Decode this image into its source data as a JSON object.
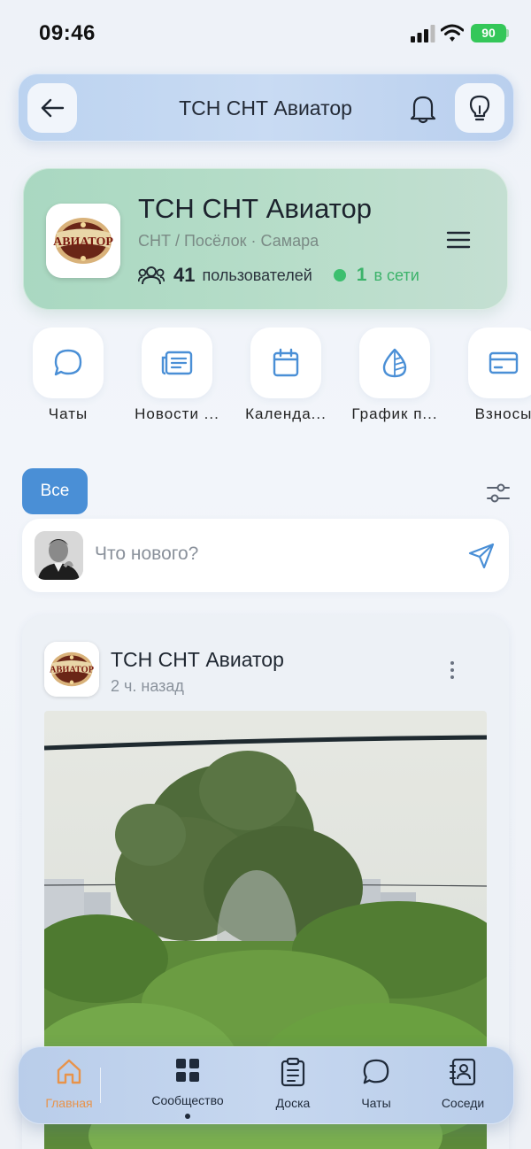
{
  "status_bar": {
    "time": "09:46",
    "battery": "90"
  },
  "top_nav": {
    "title": "ТСН СНТ Авиатор"
  },
  "community": {
    "logo_text": "АВИАТОР",
    "name": "ТСН СНТ Авиатор",
    "meta": "СНТ / Посёлок · Самара",
    "users_count": "41",
    "users_label": "пользователей",
    "online_count": "1",
    "online_label": "в сети",
    "colors": {
      "card": "#b3dbc6",
      "online": "#3cb36a"
    }
  },
  "quick_actions": [
    {
      "label": "Чаты",
      "icon": "chat-icon"
    },
    {
      "label": "Новости ...",
      "icon": "news-icon"
    },
    {
      "label": "Календа...",
      "icon": "calendar-icon"
    },
    {
      "label": "График п...",
      "icon": "drop-icon"
    },
    {
      "label": "Взносы",
      "icon": "card-icon"
    }
  ],
  "filter": {
    "active_label": "Все",
    "accent": "#4a8fd6"
  },
  "composer": {
    "placeholder": "Что нового?"
  },
  "post": {
    "author": "ТСН СНТ Авиатор",
    "time": "2 ч. назад"
  },
  "bottom_nav": [
    {
      "label": "Главная",
      "icon": "home-icon",
      "active": true
    },
    {
      "label": "Сообщество",
      "icon": "grid-icon",
      "active": false
    },
    {
      "label": "Доска",
      "icon": "clipboard-icon",
      "active": false
    },
    {
      "label": "Чаты",
      "icon": "chat-icon",
      "active": false
    },
    {
      "label": "Соседи",
      "icon": "contacts-icon",
      "active": false
    }
  ]
}
